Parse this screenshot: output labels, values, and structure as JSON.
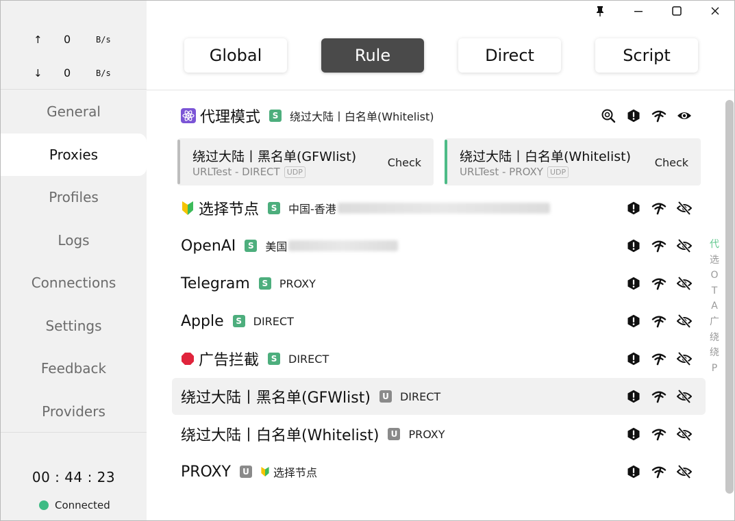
{
  "window": {
    "controls": [
      "pin-icon",
      "minimize-icon",
      "maximize-icon",
      "close-icon"
    ]
  },
  "traffic": {
    "up": {
      "arrow": "↑",
      "value": "0",
      "unit": "B/s"
    },
    "down": {
      "arrow": "↓",
      "value": "0",
      "unit": "B/s"
    }
  },
  "nav": {
    "items": [
      {
        "label": "General"
      },
      {
        "label": "Proxies"
      },
      {
        "label": "Profiles"
      },
      {
        "label": "Logs"
      },
      {
        "label": "Connections"
      },
      {
        "label": "Settings"
      },
      {
        "label": "Feedback"
      },
      {
        "label": "Providers"
      }
    ],
    "active": "Proxies"
  },
  "footer": {
    "timer": "00 : 44 : 23",
    "status": "Connected",
    "status_color": "#3dbb84"
  },
  "modes": [
    {
      "label": "Global"
    },
    {
      "label": "Rule"
    },
    {
      "label": "Direct"
    },
    {
      "label": "Script"
    }
  ],
  "active_mode": "Rule",
  "groups": {
    "g0": {
      "emoji": "⚛",
      "name": "代理模式",
      "type": "S",
      "now": "绕过大陆丨白名单(Whitelist)"
    },
    "g1": {
      "emoji": "🔰",
      "name": "选择节点",
      "type": "S",
      "now": "中国-香港"
    },
    "g2": {
      "name": "OpenAI",
      "type": "S",
      "now": "美国"
    },
    "g3": {
      "name": "Telegram",
      "type": "S",
      "now": "PROXY"
    },
    "g4": {
      "name": "Apple",
      "type": "S",
      "now": "DIRECT"
    },
    "g5": {
      "emoji": "🛑",
      "name": "广告拦截",
      "type": "S",
      "now": "DIRECT"
    },
    "g6": {
      "name": "绕过大陆丨黑名单(GFWlist)",
      "type": "U",
      "now": "DIRECT"
    },
    "g7": {
      "name": "绕过大陆丨白名单(Whitelist)",
      "type": "U",
      "now": "PROXY"
    },
    "g8": {
      "name": "PROXY",
      "type": "U",
      "now_emoji": "🔰",
      "now": "选择节点"
    }
  },
  "cards": [
    {
      "title": "绕过大陆丨黑名单(GFWlist)",
      "sub": "URLTest - DIRECT",
      "tag": "UDP",
      "action": "Check",
      "bar_color": "#bdbdbd"
    },
    {
      "title": "绕过大陆丨白名单(Whitelist)",
      "sub": "URLTest - PROXY",
      "tag": "UDP",
      "action": "Check",
      "bar_color": "#4dbb87"
    }
  ],
  "index": [
    "代",
    "选",
    "O",
    "T",
    "A",
    "广",
    "绕",
    "绕",
    "P"
  ],
  "index_active": "代",
  "colors": {
    "accent": "#4a4a4a",
    "success": "#4dae7d",
    "sidebar_bg": "#f1f1f1"
  }
}
